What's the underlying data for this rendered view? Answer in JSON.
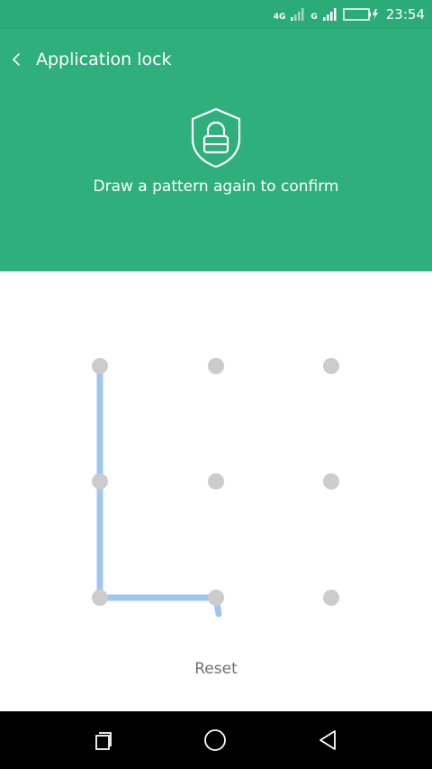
{
  "status_bar": {
    "network_label_1": "4G",
    "network_label_2": "G",
    "time": "23:54",
    "icons": [
      "signal-4g-icon",
      "signal-g-icon",
      "signal-bars-icon",
      "battery-charging-icon"
    ]
  },
  "header": {
    "title": "Application lock",
    "icon": "shield-lock-icon",
    "instruction": "Draw a pattern again to confirm"
  },
  "pattern": {
    "rows": 3,
    "cols": 3,
    "drawn_path": [
      1,
      4,
      7,
      8
    ]
  },
  "actions": {
    "reset_label": "Reset"
  },
  "nav_bar": {
    "icons": [
      "recent-apps-icon",
      "home-icon",
      "back-icon"
    ]
  },
  "colors": {
    "header_green": "#2eaf7b",
    "dot_gray": "#cccccc",
    "path_blue": "#9ec7ef",
    "reset_text": "#6f6f6f"
  }
}
